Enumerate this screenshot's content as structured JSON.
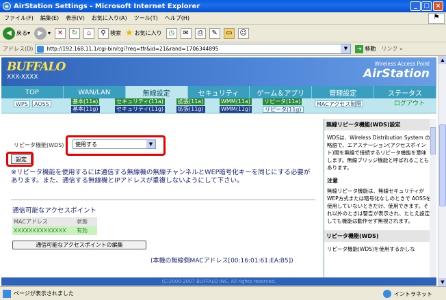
{
  "window": {
    "title": "AirStation Settings - Microsoft Internet Explorer"
  },
  "menu": [
    "ファイル(F)",
    "編集(E)",
    "表示(V)",
    "お気に入り(A)",
    "ツール(T)",
    "ヘルプ(H)"
  ],
  "toolbar": {
    "back": "戻る",
    "search": "検索",
    "favorites": "お気に入り"
  },
  "address": {
    "label": "アドレス(D)",
    "url": "http://192.168.11.1/cgi-bin/cgi?req=tfr&id=21&rand=1706344895",
    "go": "移動",
    "links": "リンク"
  },
  "banner": {
    "logo": "BUFFALO",
    "model": "XXX-XXXX",
    "tagline": "Wireless Access Point",
    "product": "AirStation"
  },
  "main_tabs": [
    "TOP",
    "WAN/LAN",
    "無線設定",
    "セキュリティ",
    "ゲーム＆アプリ",
    "管理設定",
    "ステータス"
  ],
  "sub_tabs": {
    "wps": "WPS",
    "aoss": "AOSS",
    "basic_a": "基本(11a)",
    "sec_a": "セキュリティ(11a)",
    "ext_a": "拡張(11a)",
    "wmm_a": "WMM(11a)",
    "rep_a": "リピータ(11a)",
    "basic_g": "基本(11g)",
    "sec_g": "セキュリティ(11g)",
    "ext_g": "拡張(11g)",
    "wmm_g": "WMM(11g)",
    "rep_g": "リピータ(11g)",
    "mac": "MACアクセス制限",
    "logout": "ログアウト"
  },
  "form": {
    "label": "リピータ機能(WDS)",
    "selected": "使用する",
    "set_button": "設定"
  },
  "warning": "※リピータ機能を使用するには通信する無線機の無線チャンネルとWEP暗号化キーを同じにする必要があります。また、通信する無線機とIPアドレスが重複しないようにして下さい。",
  "ap": {
    "title": "通信可能なアクセスポイント",
    "headers": [
      "MACアドレス",
      "状態"
    ],
    "rows": [
      [
        "XXXXXXXXXXXXXX",
        "有効"
      ]
    ],
    "edit_button": "通信可能なアクセスポイントの編集"
  },
  "mac_note": "(本機の無線側MACアドレス[00:16:01:61:EA:B5])",
  "footer": "(C)2000-2007 BUFFALO INC. All rights reserved.",
  "help": {
    "heading": "無線リピータ機能(WDS)設定",
    "p1": "WDSは、Wireless Distribution System の略語で、エアステーション(アクセスポイント)間を無線で接続するリピータ機能を意味します。無線ブリッジ機能と呼ばれることもあります。",
    "note_title": "注意",
    "note": "無線リピータ機能は、無線セキュリティがWEP方式または暗号化なしのときで AOSSを使用していないときだけ、使用できます。それ以外のときは警告が表示され、たとえ設定しても機能は動作せず無視されます。",
    "heading2": "リピータ機能(WDS)",
    "p2": "リピータ機能(WDS)を使用するかしな"
  },
  "status": {
    "left": "ページが表示されました",
    "zone": "イントラネット"
  }
}
